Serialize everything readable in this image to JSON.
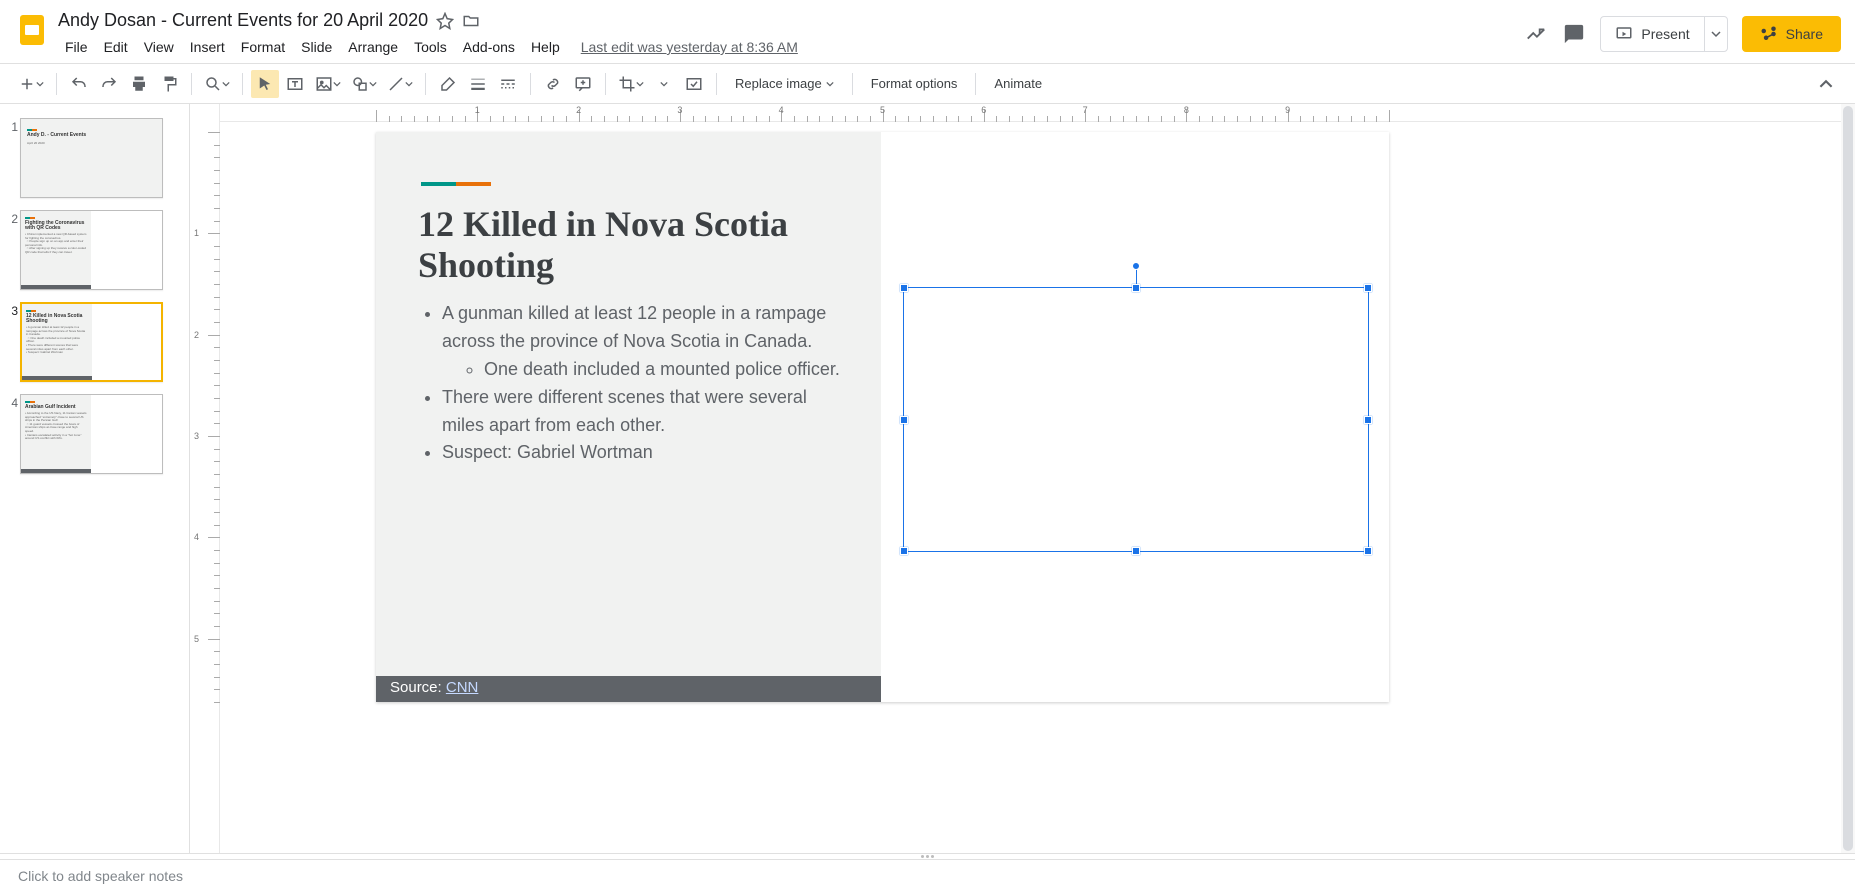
{
  "header": {
    "doc_title": "Andy Dosan - Current Events for 20 April 2020",
    "last_edit": "Last edit was yesterday at 8:36 AM",
    "present": "Present",
    "share": "Share"
  },
  "menu": [
    "File",
    "Edit",
    "View",
    "Insert",
    "Format",
    "Slide",
    "Arrange",
    "Tools",
    "Add-ons",
    "Help"
  ],
  "toolbar": {
    "replace_image": "Replace image",
    "format_options": "Format options",
    "animate": "Animate"
  },
  "thumbs": [
    {
      "n": "1",
      "title": "Andy D. - Current Events",
      "sub": "April 20 2020"
    },
    {
      "n": "2",
      "title": "Fighting the Coronavirus with QR Codes"
    },
    {
      "n": "3",
      "title": "12 Killed in Nova Scotia Shooting"
    },
    {
      "n": "4",
      "title": "Arabian Gulf Incident"
    }
  ],
  "slide": {
    "title": "12 Killed in Nova Scotia Shooting",
    "bullets": [
      "A gunman killed at least 12 people in a rampage across the province of Nova Scotia in Canada.",
      "There were different scenes that were several miles apart from each other.",
      "Suspect: Gabriel Wortman"
    ],
    "sub_bullet": "One death included a mounted police officer.",
    "source_label": "Source:",
    "source_link": " CNN"
  },
  "notes_placeholder": "Click to add speaker notes",
  "ruler": {
    "h": [
      "1",
      "2",
      "3",
      "4",
      "5",
      "6",
      "7",
      "8",
      "9"
    ],
    "v": [
      "1",
      "2",
      "3",
      "4",
      "5"
    ]
  }
}
